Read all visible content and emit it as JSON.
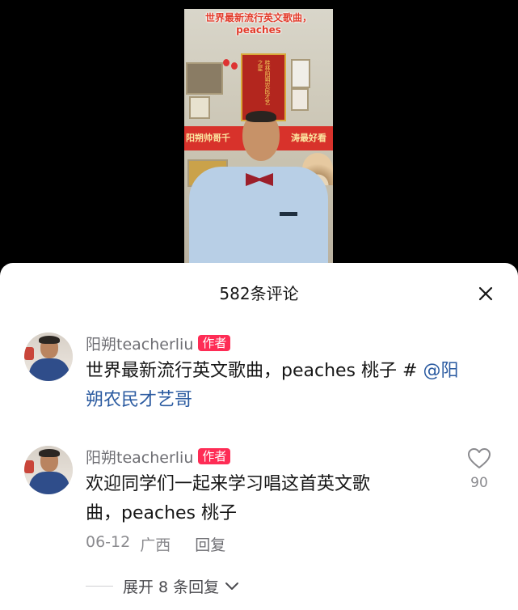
{
  "video": {
    "caption_line1": "世界最新流行英文歌曲，",
    "caption_line2": "peaches",
    "pennant_text": "桂林阳朔农民才艺之星",
    "banner_left": "阳朔帅哥千",
    "banner_right": "涛最好看"
  },
  "sheet": {
    "title": "582条评论",
    "close_icon": "close-icon"
  },
  "comments": [
    {
      "username": "阳朔teacherliu",
      "badge": "作者",
      "text_main": "世界最新流行英文歌曲，peaches 桃子 # ",
      "mention": "@阳朔农民才艺哥"
    },
    {
      "username": "阳朔teacherliu",
      "badge": "作者",
      "text_line1": "欢迎同学们一起来学习唱这首英文歌",
      "text_line2": "曲，peaches 桃子",
      "date": "06-12",
      "region": "广西",
      "reply_label": "回复",
      "like_count": "90",
      "like_icon": "heart-outline-icon"
    }
  ],
  "expand_replies": {
    "label": "展开 8 条回复",
    "icon": "chevron-down-icon"
  },
  "colors": {
    "badge": "#fe2c55",
    "mention": "#2a5aa0",
    "caption": "#e23b2a"
  }
}
